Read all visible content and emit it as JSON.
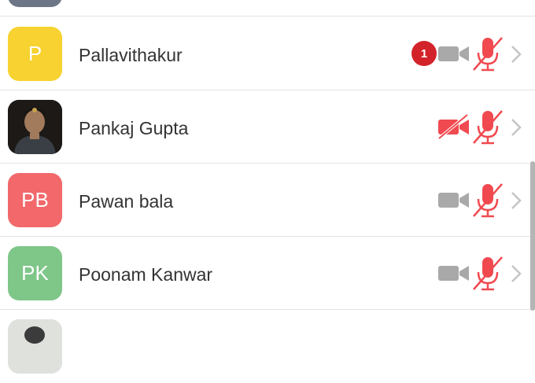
{
  "participants": [
    {
      "name": "Pallavithakur",
      "initials": "P",
      "avatar_color": "#f7d230",
      "unread": "1",
      "video": "off-gray",
      "mic": "muted"
    },
    {
      "name": "Pankaj Gupta",
      "initials": "",
      "avatar_color": "#2a2520",
      "unread": "",
      "video": "off-red",
      "mic": "muted"
    },
    {
      "name": "Pawan bala",
      "initials": "PB",
      "avatar_color": "#f2686b",
      "unread": "",
      "video": "off-gray",
      "mic": "muted"
    },
    {
      "name": "Poonam Kanwar",
      "initials": "PK",
      "avatar_color": "#7fc689",
      "unread": "",
      "video": "off-gray",
      "mic": "muted"
    }
  ],
  "colors": {
    "muted_red": "#f04a50",
    "gray_icon": "#a9a9a9",
    "chevron": "#c4c4c4"
  }
}
